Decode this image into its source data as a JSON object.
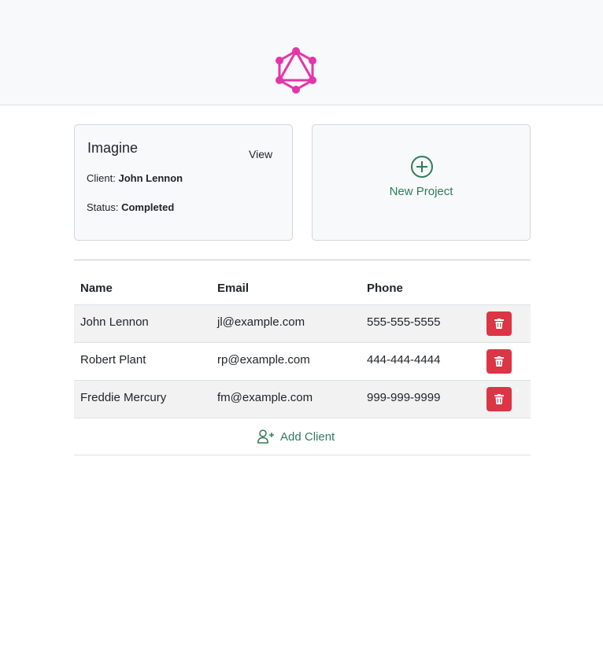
{
  "navbar": {
    "logo_icon": "graphql-logo-icon",
    "logo_color": "#e535ab"
  },
  "project": {
    "name": "Imagine",
    "view_label": "View",
    "client_label": "Client:",
    "client_value": "John Lennon",
    "status_label": "Status:",
    "status_value": "Completed"
  },
  "new_project": {
    "icon": "plus-circle-icon",
    "label": "New Project"
  },
  "clients_table": {
    "headers": {
      "name": "Name",
      "email": "Email",
      "phone": "Phone"
    },
    "rows": [
      {
        "name": "John Lennon",
        "email": "jl@example.com",
        "phone": "555-555-5555"
      },
      {
        "name": "Robert Plant",
        "email": "rp@example.com",
        "phone": "444-444-4444"
      },
      {
        "name": "Freddie Mercury",
        "email": "fm@example.com",
        "phone": "999-999-9999"
      }
    ],
    "delete_icon": "trash-icon",
    "delete_color": "#dc3545"
  },
  "add_client": {
    "icon": "user-plus-icon",
    "label": "Add Client"
  },
  "colors": {
    "accent_green": "#2e7d57",
    "navbar_bg": "#f8f9fa"
  }
}
